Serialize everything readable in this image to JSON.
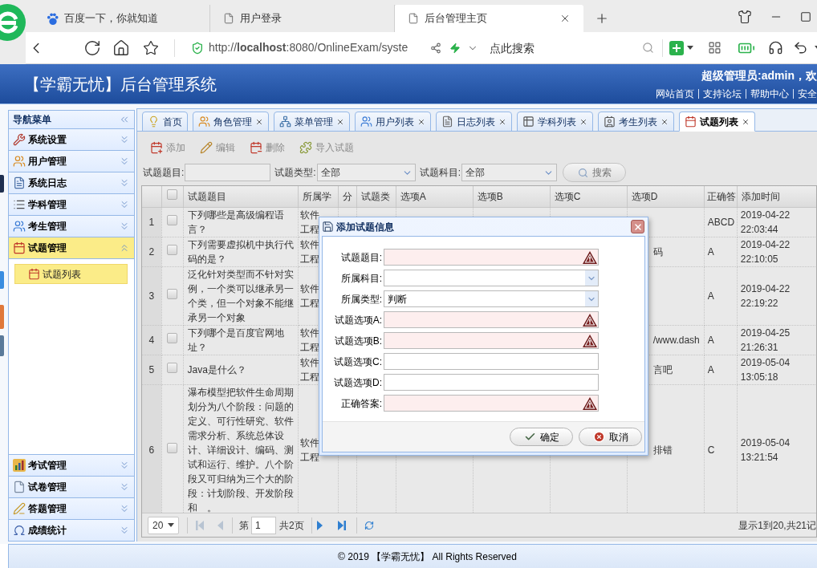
{
  "browser": {
    "tabs": [
      {
        "title": "百度一下，你就知道",
        "selected": false
      },
      {
        "title": "用户登录",
        "selected": false
      },
      {
        "title": "后台管理主页",
        "selected": true
      }
    ],
    "address": "http://**localhost**:8080/OnlineExam/syste",
    "search_placeholder": "点此搜索"
  },
  "header": {
    "title": "【学霸无忧】后台管理系统",
    "greeting": "超级管理员:admin，欢",
    "links": [
      "网站首页",
      "支持论坛",
      "帮助中心",
      "安全"
    ]
  },
  "nav_menu": {
    "title": "导航菜单",
    "groups": [
      {
        "label": "系统设置",
        "selected": false,
        "expanded": false
      },
      {
        "label": "用户管理",
        "selected": false,
        "expanded": false
      },
      {
        "label": "系统日志",
        "selected": false,
        "expanded": false
      },
      {
        "label": "学科管理",
        "selected": false,
        "expanded": false
      },
      {
        "label": "考生管理",
        "selected": false,
        "expanded": false
      },
      {
        "label": "试题管理",
        "selected": true,
        "expanded": true,
        "children": [
          {
            "label": "试题列表",
            "selected": true
          }
        ]
      },
      {
        "label": "考试管理",
        "selected": false,
        "expanded": false
      },
      {
        "label": "试卷管理",
        "selected": false,
        "expanded": false
      },
      {
        "label": "答题管理",
        "selected": false,
        "expanded": false
      },
      {
        "label": "成绩统计",
        "selected": false,
        "expanded": false
      }
    ]
  },
  "content_tabs": [
    {
      "label": "首页",
      "selected": false,
      "closable": false
    },
    {
      "label": "角色管理",
      "selected": false,
      "closable": true
    },
    {
      "label": "菜单管理",
      "selected": false,
      "closable": true
    },
    {
      "label": "用户列表",
      "selected": false,
      "closable": true
    },
    {
      "label": "日志列表",
      "selected": false,
      "closable": true
    },
    {
      "label": "学科列表",
      "selected": false,
      "closable": true
    },
    {
      "label": "考生列表",
      "selected": false,
      "closable": true
    },
    {
      "label": "试题列表",
      "selected": true,
      "closable": true
    }
  ],
  "toolbar": [
    "添加",
    "编辑",
    "删除",
    "导入试题"
  ],
  "search_form": {
    "fields": [
      {
        "label": "试题题目:",
        "kind": "text"
      },
      {
        "label": "试题类型:",
        "kind": "select",
        "value": "全部"
      },
      {
        "label": "试题科目:",
        "kind": "select",
        "value": "全部"
      }
    ],
    "button": "搜索"
  },
  "table": {
    "header_checked": false,
    "columns": [
      "试题题目",
      "所属学",
      "分",
      "试题类",
      "选项A",
      "选项B",
      "选项C",
      "选项D",
      "正确答",
      "添加时间"
    ],
    "rows": [
      {
        "number": "1",
        "checked": false,
        "title": "下列哪些是高级编程语言？",
        "subject": "软件工程",
        "answer": "ABCD",
        "added_time": "2019-04-22 22:03:44"
      },
      {
        "number": "2",
        "checked": false,
        "title": "下列需要虚拟机中执行代码的是？",
        "subject": "软件工程",
        "option_d": "码",
        "answer": "A",
        "added_time": "2019-04-22 22:10:05"
      },
      {
        "number": "3",
        "checked": false,
        "title": "泛化针对类型而不针对实例，一个类可以继承另一个类，但一个对象不能继承另一个对象",
        "subject": "软件工程",
        "answer": "A",
        "added_time": "2019-04-22 22:19:22"
      },
      {
        "number": "4",
        "checked": false,
        "title": "下列哪个是百度官网地址？",
        "subject": "软件工程",
        "option_d": "/www.dash",
        "answer": "A",
        "added_time": "2019-04-25 21:26:31"
      },
      {
        "number": "5",
        "checked": false,
        "title": "Java是什么？",
        "subject": "软件工程",
        "option_d": "言吧",
        "answer": "A",
        "added_time": "2019-05-04 13:05:18"
      },
      {
        "number": "6",
        "checked": false,
        "title": "瀑布模型把软件生命周期划分为八个阶段：问题的定义、可行性研究、软件需求分析、系统总体设计、详细设计、编码、测试和运行、维护。八个阶段又可归纳为三个大的阶段：计划阶段、开发阶段和　。",
        "subject": "软件工程",
        "option_d": "排错",
        "answer": "C",
        "added_time": "2019-05-04 13:21:54"
      }
    ]
  },
  "pagination": {
    "page_size": "20",
    "page_prefix": "第",
    "page": "1",
    "page_suffix": "共2页",
    "buttons": [
      {
        "kind": "first",
        "disabled": true
      },
      {
        "kind": "prev",
        "disabled": true
      },
      {
        "kind": "next",
        "disabled": false
      },
      {
        "kind": "last",
        "disabled": false
      }
    ],
    "summary": "显示1到20,共21记"
  },
  "dialog": {
    "title": "添加试题信息",
    "fields": [
      {
        "label": "试题题目:",
        "kind": "text",
        "invalid": true
      },
      {
        "label": "所属科目:",
        "kind": "combo",
        "invalid": false
      },
      {
        "label": "所属类型:",
        "kind": "combo",
        "value": "判断",
        "invalid": false
      },
      {
        "label": "试题选项A:",
        "kind": "text",
        "invalid": true
      },
      {
        "label": "试题选项B:",
        "kind": "text",
        "invalid": true
      },
      {
        "label": "试题选项C:",
        "kind": "text",
        "invalid": false
      },
      {
        "label": "试题选项D:",
        "kind": "text",
        "invalid": false
      },
      {
        "label": "正确答案:",
        "kind": "text",
        "invalid": true
      }
    ],
    "buttons": [
      {
        "label": "确定",
        "kind": "ok"
      },
      {
        "label": "取消",
        "kind": "cancel"
      }
    ]
  },
  "footer": "© 2019 【学霸无忧】 All Rights Reserved"
}
